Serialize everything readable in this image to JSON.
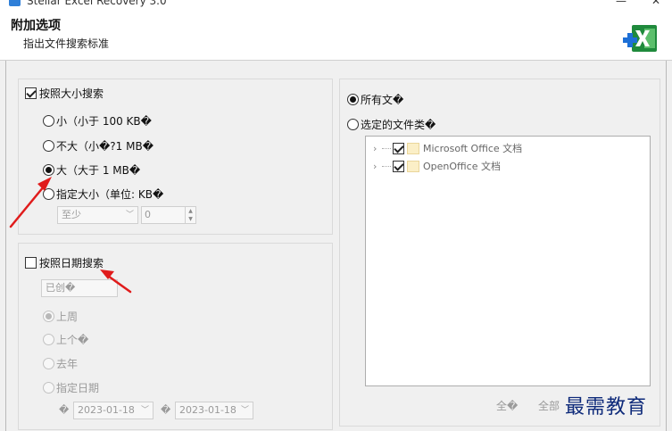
{
  "window": {
    "title": "Stellar Excel Recovery 3.0",
    "minimize": "—",
    "close": "✕"
  },
  "header": {
    "title": "附加选项",
    "subtitle": "指出文件搜索标准"
  },
  "size_search": {
    "checkbox_label": "按照大小搜索",
    "checked": true,
    "options": [
      {
        "label": "小（小于 100 KB�",
        "checked": false
      },
      {
        "label": "不大（小�?1 MB�",
        "checked": false
      },
      {
        "label": "大（大于 1 MB�",
        "checked": true
      },
      {
        "label": "指定大小（单位: KB�",
        "checked": false
      }
    ],
    "limit_combo": "至少",
    "size_value": "0"
  },
  "date_search": {
    "checkbox_label": "按照日期搜索",
    "checked": false,
    "type_combo": "已创�",
    "options": [
      {
        "label": "上周",
        "checked": true
      },
      {
        "label": "上个�",
        "checked": false
      },
      {
        "label": "去年",
        "checked": false
      },
      {
        "label": "指定日期",
        "checked": false
      }
    ],
    "from_prefix": "�",
    "from_date": "2023-01-18",
    "to_prefix": "�",
    "to_date": "2023-01-18"
  },
  "file_type": {
    "all_label": "所有文�",
    "selected_label": "选定的文件类�",
    "all_checked": true,
    "tree": [
      {
        "label": "Microsoft Office 文档",
        "checked": true
      },
      {
        "label": "OpenOffice 文档",
        "checked": true
      }
    ],
    "select_all": "全�",
    "deselect_all": "全部"
  },
  "watermark": "最需教育",
  "colors": {
    "annotation_arrow": "#e01c1c",
    "excel_green": "#1f8a3c",
    "watermark": "#0e2a7a"
  }
}
